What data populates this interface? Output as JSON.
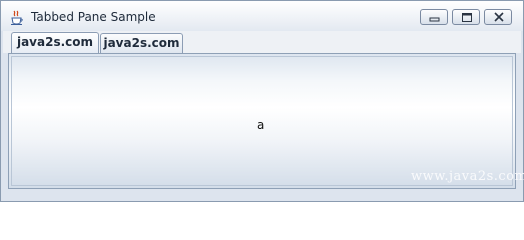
{
  "window": {
    "title": "Tabbed Pane Sample",
    "icon": "java-cup-icon",
    "controls": [
      "minimize-icon",
      "maximize-icon",
      "close-icon"
    ]
  },
  "tabs": [
    {
      "label": "java2s.com",
      "selected": true
    },
    {
      "label": "java2s.com",
      "selected": false
    }
  ],
  "content": {
    "label": "a"
  },
  "watermark": "www.java2s.com",
  "colors": {
    "border": "#8a9bb0",
    "tab_border": "#8c9db4",
    "text": "#1f2b3b"
  }
}
